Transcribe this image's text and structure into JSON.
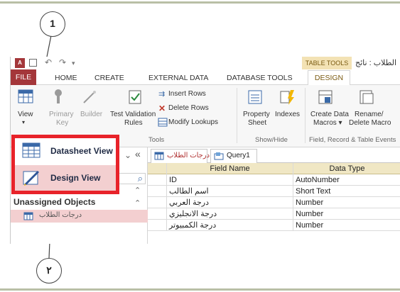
{
  "quick_access": {
    "app_logo": "A",
    "undo_glyph": "↶",
    "redo_glyph": "↷",
    "more_glyph": "▾",
    "context_group": "TABLE TOOLS",
    "window_title": "الطلاب : نائج"
  },
  "tabs": [
    "FILE",
    "HOME",
    "CREATE",
    "EXTERNAL DATA",
    "DATABASE TOOLS",
    "DESIGN"
  ],
  "ribbon": {
    "view": "View",
    "view_arrow": "▾",
    "primary_key_1": "Primary",
    "primary_key_2": "Key",
    "builder": "Builder",
    "test_validation_1": "Test Validation",
    "test_validation_2": "Rules",
    "insert_rows": "Insert Rows",
    "delete_rows": "Delete Rows",
    "modify_lookups": "Modify Lookups",
    "tools_group": "Tools",
    "property_sheet_1": "Property",
    "property_sheet_2": "Sheet",
    "indexes": "Indexes",
    "show_hide_group": "Show/Hide",
    "create_data_macros_1": "Create Data",
    "create_data_macros_2": "Macros ▾",
    "rename_delete_macro_1": "Rename/",
    "rename_delete_macro_2": "Delete Macro",
    "field_record_group": "Field, Record & Table Events"
  },
  "view_menu": {
    "datasheet_view": "Datasheet View",
    "design_view": "Design View"
  },
  "nav_pane": {
    "collapse": "«",
    "dropdown": "⌄",
    "search_icon": "⌕",
    "group_title": "Unassigned Objects",
    "chevron": "⌃",
    "item": "درجات الطلاب"
  },
  "doc_tabs": {
    "table_tab": "درجات الطلاب",
    "query_tab": "Query1"
  },
  "grid": {
    "headers": [
      "Field Name",
      "Data Type"
    ],
    "rows": [
      [
        "ID",
        "AutoNumber"
      ],
      [
        "اسم الطالب",
        "Short Text"
      ],
      [
        "درجة العربي",
        "Number"
      ],
      [
        "درجة الانجليزي",
        "Number"
      ],
      [
        "درجة الكمبيوتر",
        "Number"
      ]
    ]
  },
  "callouts": [
    "1",
    "٢"
  ]
}
